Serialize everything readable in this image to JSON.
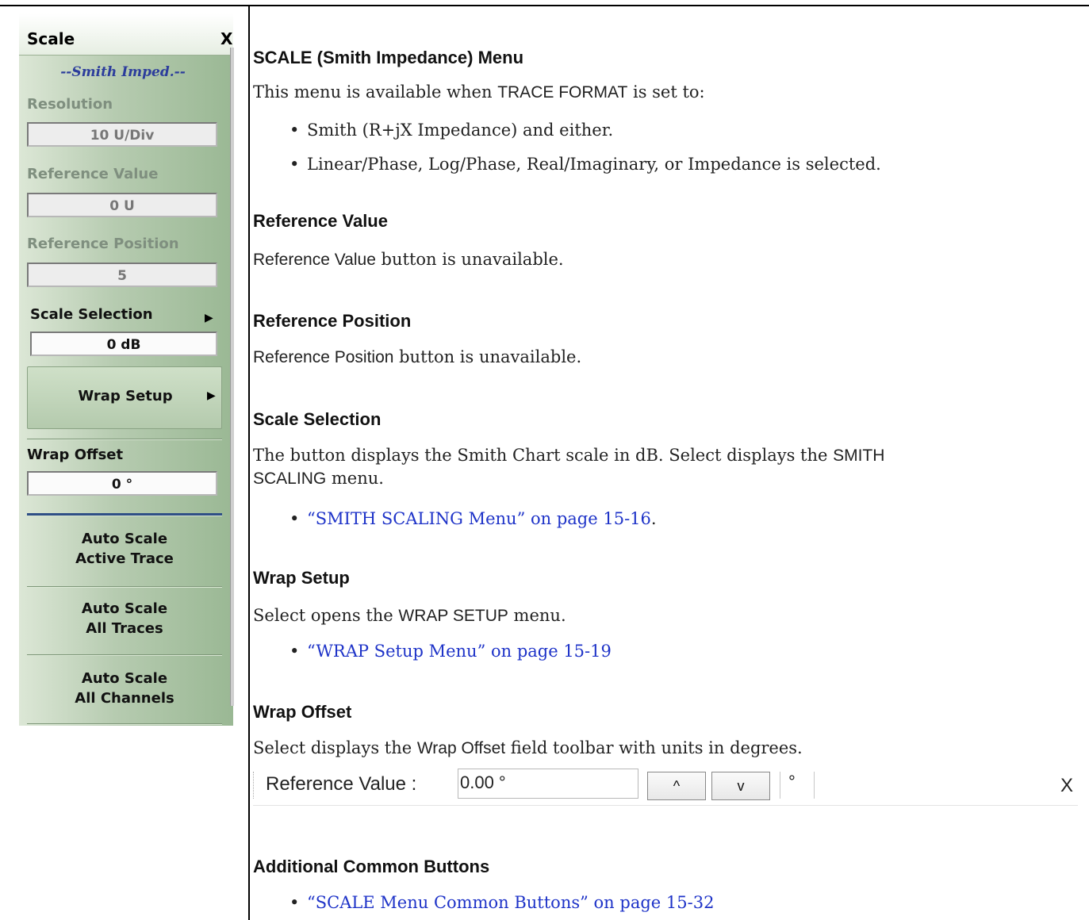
{
  "panel": {
    "title": "Scale",
    "close": "X",
    "subtitle": "--Smith Imped.--",
    "resolution_label": "Resolution",
    "resolution_value": "10  U/Div",
    "ref_value_label": "Reference Value",
    "ref_value_value": "0  U",
    "ref_pos_label": "Reference Position",
    "ref_pos_value": "5",
    "scale_sel_label": "Scale Selection",
    "scale_sel_value": "0 dB",
    "wrap_setup": "Wrap Setup",
    "wrap_offset_label": "Wrap Offset",
    "wrap_offset_value": "0 °",
    "auto_active_1": "Auto Scale",
    "auto_active_2": "Active Trace",
    "auto_all_traces_1": "Auto Scale",
    "auto_all_traces_2": "All Traces",
    "auto_all_ch_1": "Auto Scale",
    "auto_all_ch_2": "All Channels"
  },
  "doc": {
    "h_menu": "SCALE (Smith Impedance) Menu",
    "p_menu_1": "This menu is available when ",
    "p_menu_2": "TRACE FORMAT",
    "p_menu_3": " is set to:",
    "b_menu_1": "Smith (R+jX Impedance) and either.",
    "b_menu_2": "Linear/Phase, Log/Phase, Real/Imaginary, or Impedance is selected.",
    "h_refval": "Reference Value",
    "p_refval_1": "Reference Value",
    "p_refval_2": " button is unavailable.",
    "h_refpos": "Reference Position",
    "p_refpos_1": "Reference Position",
    "p_refpos_2": " button is unavailable.",
    "h_scalesel": "Scale Selection",
    "p_scalesel_1": "The button displays the Smith Chart scale in dB. Select displays the ",
    "p_scalesel_2": "SMITH",
    "p_scalesel_3": "SCALING",
    "p_scalesel_4": " menu.",
    "b_scalesel_link": "“SMITH SCALING Menu” on page 15-16",
    "b_scalesel_tail": ".",
    "h_wrapsetup": "Wrap Setup",
    "p_wrapsetup_1": "Select opens the ",
    "p_wrapsetup_2": "WRAP SETUP",
    "p_wrapsetup_3": " menu.",
    "b_wrapsetup_link": "“WRAP Setup Menu” on page 15-19",
    "h_wrapoffset": "Wrap Offset",
    "p_wrapoffset_1": "Select displays the ",
    "p_wrapoffset_2": "Wrap Offset",
    "p_wrapoffset_3": " field toolbar with units in degrees.",
    "h_common": "Additional Common Buttons",
    "b_common_link": "“SCALE Menu Common Buttons” on page 15-32"
  },
  "toolbar": {
    "label": "Reference Value  :",
    "value": "0.00 °",
    "up": "^",
    "down": "v",
    "unit": "°",
    "close": "X"
  },
  "bullet_char": "•"
}
